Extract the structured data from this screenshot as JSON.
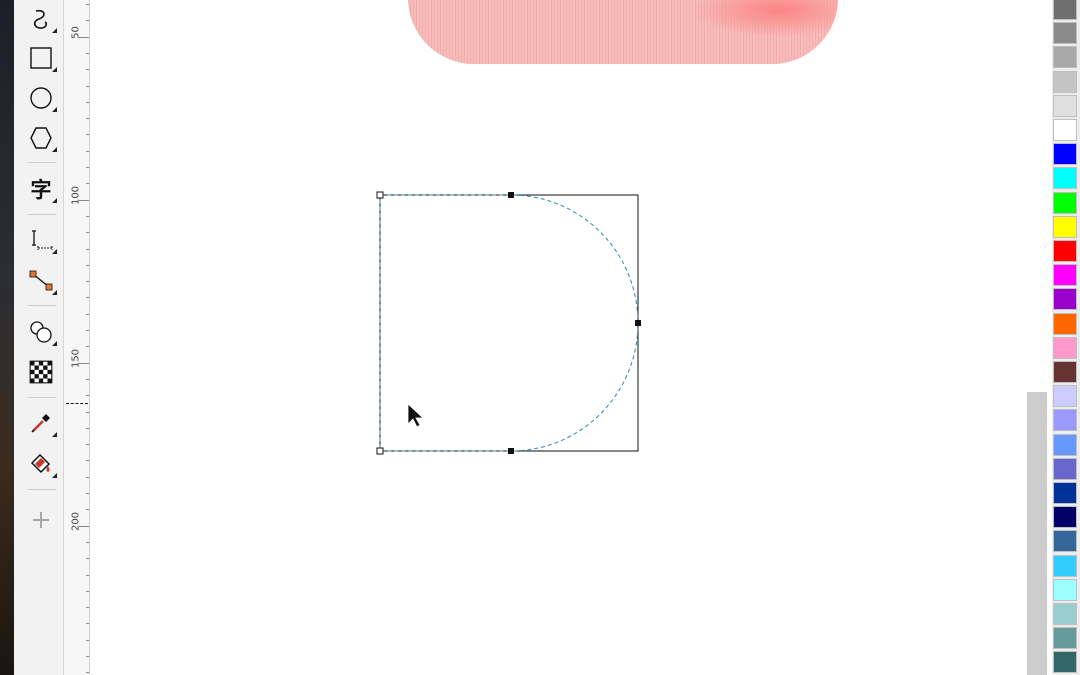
{
  "window": {
    "background": "#ffffff"
  },
  "toolbox": {
    "tools": [
      {
        "id": "freehand",
        "icon": "freehand-curve-icon",
        "label": "",
        "has_flyout": true
      },
      {
        "id": "rectangle",
        "icon": "rectangle-icon",
        "label": "",
        "has_flyout": true
      },
      {
        "id": "ellipse",
        "icon": "ellipse-icon",
        "label": "",
        "has_flyout": true
      },
      {
        "id": "polygon",
        "icon": "polygon-icon",
        "label": "",
        "has_flyout": true
      },
      {
        "id": "text",
        "icon": "text-tool-icon",
        "label": "字",
        "has_flyout": true
      },
      {
        "id": "dimension",
        "icon": "dimension-icon",
        "label": "",
        "has_flyout": true
      },
      {
        "id": "connector",
        "icon": "connector-icon",
        "label": "",
        "has_flyout": true
      },
      {
        "id": "blend",
        "icon": "blend-icon",
        "label": "",
        "has_flyout": true
      },
      {
        "id": "transparency",
        "icon": "transparency-icon",
        "label": "",
        "has_flyout": false
      },
      {
        "id": "eyedropper",
        "icon": "eyedropper-icon",
        "label": "",
        "has_flyout": true
      },
      {
        "id": "interactive-fill",
        "icon": "fill-bucket-icon",
        "label": "",
        "has_flyout": true
      },
      {
        "id": "add-tool",
        "icon": "plus-icon",
        "label": "",
        "has_flyout": false
      }
    ]
  },
  "ruler": {
    "labels": [
      "50",
      "100",
      "150",
      "200"
    ]
  },
  "canvas": {
    "selection_handles": 6,
    "outline_color": "#000000",
    "dashed_curve_color": "#2e86c1",
    "pink_object_color": "#f4b3b1"
  },
  "palette": {
    "swatches": [
      "#6e6e6e",
      "#8a8a8a",
      "#a8a8a8",
      "#c4c4c4",
      "#e0e0e0",
      "#ffffff",
      "#0000ff",
      "#00ffff",
      "#00ff00",
      "#ffff00",
      "#ff0000",
      "#ff00ff",
      "#9900cc",
      "#ff6600",
      "#ff99cc",
      "#663333",
      "#ccccff",
      "#9999ff",
      "#6699ff",
      "#6666cc",
      "#003399",
      "#000066",
      "#336699",
      "#33ccff",
      "#99ffff",
      "#99cccc",
      "#669999",
      "#336666"
    ]
  }
}
